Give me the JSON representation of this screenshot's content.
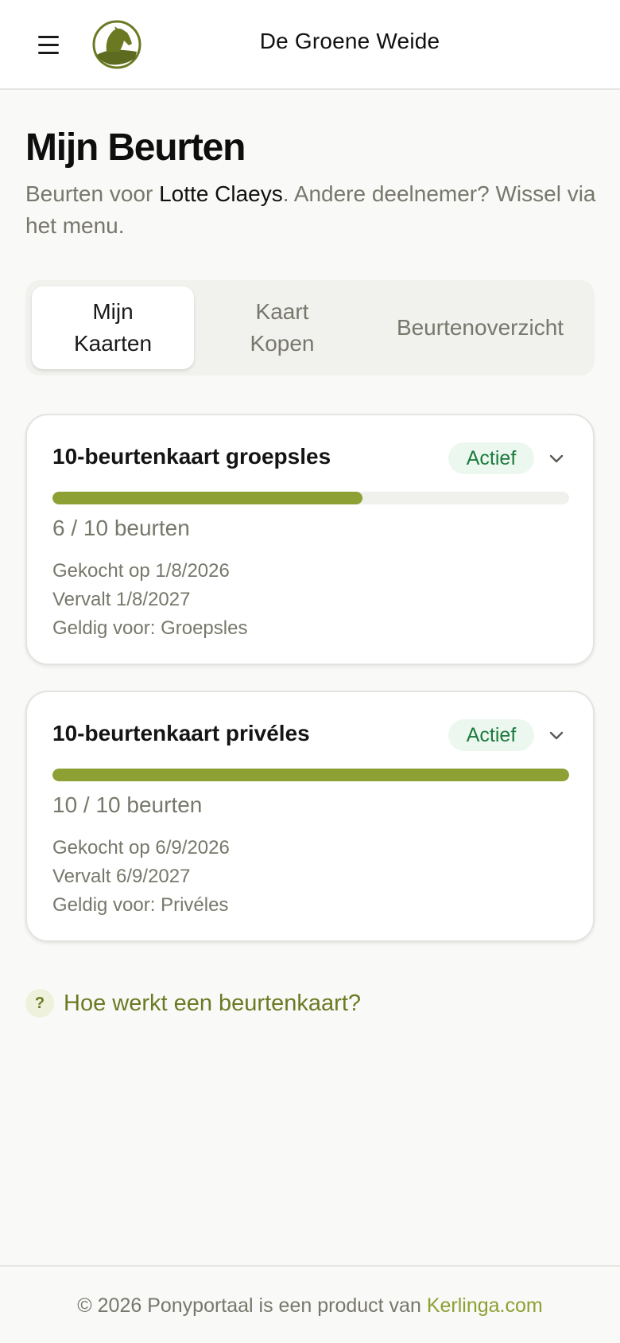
{
  "header": {
    "title": "De Groene Weide",
    "menu_icon": "hamburger-menu-icon",
    "logo_icon": "horse-head-logo"
  },
  "page": {
    "title": "Mijn Beurten",
    "subtitle_prefix": "Beurten voor ",
    "participant_name": "Lotte Claeys",
    "subtitle_suffix": ". Andere deelnemer? Wissel via het menu."
  },
  "tabs": [
    {
      "label_line1": "Mijn",
      "label_line2": "Kaarten",
      "active": true
    },
    {
      "label_line1": "Kaart",
      "label_line2": "Kopen",
      "active": false
    },
    {
      "label_line1": "Beurtenoverzicht",
      "label_line2": "",
      "active": false
    }
  ],
  "cards": [
    {
      "title": "10-beurtenkaart groepsles",
      "status": "Actief",
      "used": 6,
      "total": 10,
      "count_text": "6 / 10 beurten",
      "purchased": "Gekocht op 1/8/2026",
      "expires": "Vervalt 1/8/2027",
      "valid_for": "Geldig voor: Groepsles"
    },
    {
      "title": "10-beurtenkaart privéles",
      "status": "Actief",
      "used": 10,
      "total": 10,
      "count_text": "10 / 10 beurten",
      "purchased": "Gekocht op 6/9/2026",
      "expires": "Vervalt 6/9/2027",
      "valid_for": "Geldig voor: Privéles"
    }
  ],
  "help": {
    "icon_text": "?",
    "label": "Hoe werkt een beurtenkaart?"
  },
  "footer": {
    "text": "© 2026 Ponyportaal is een product van ",
    "link": "Kerlinga.com"
  },
  "colors": {
    "accent": "#8ca033",
    "accent_dark": "#6b7a22",
    "status_bg": "#ecf8ef",
    "status_text": "#1d7a3e",
    "muted_text": "#77776c"
  }
}
